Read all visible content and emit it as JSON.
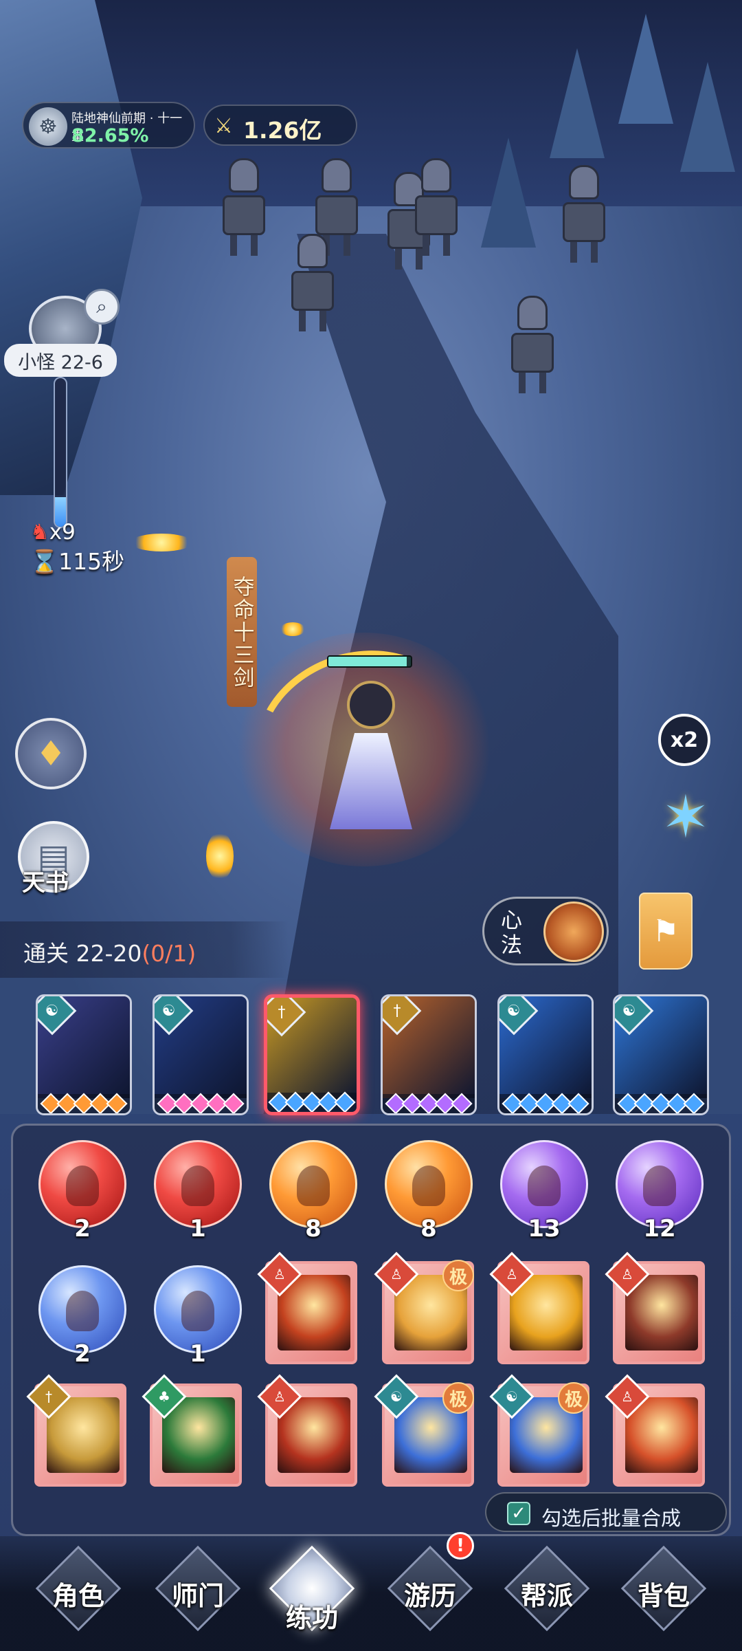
{
  "hud": {
    "realm": "陆地神仙前期 · 十一重",
    "realm_progress": "82.65%",
    "power": "1.26亿",
    "stage": "小怪 22-6",
    "wave_progress": 0.2,
    "kills": "x9",
    "timer": "115秒",
    "skill_banner": "夺命十三剑",
    "hero_hp": 0.95,
    "speed": "x2"
  },
  "side": {
    "book_label": "天书",
    "xinfa_label": "心法"
  },
  "clear": {
    "label": "通关 22-20",
    "progress": "(0/1)"
  },
  "skills": [
    {
      "icon": "yin-yang-icon",
      "gem": "#2d8a92",
      "pip": "#ff9a35",
      "art": "#3a3f8a"
    },
    {
      "icon": "yin-yang-icon",
      "gem": "#2d8a92",
      "pip": "#ff6fc0",
      "art": "#233d86"
    },
    {
      "icon": "sword-icon",
      "gem": "#b88a2a",
      "pip": "#4aa5ff",
      "art": "#c99a24",
      "active": true
    },
    {
      "icon": "sword-icon",
      "gem": "#b88a2a",
      "pip": "#b36cff",
      "art": "#b8632c"
    },
    {
      "icon": "yin-yang-icon",
      "gem": "#2d8a92",
      "pip": "#4aa5ff",
      "art": "#2c6bd0"
    },
    {
      "icon": "yin-yang-icon",
      "gem": "#2d8a92",
      "pip": "#4aa5ff",
      "art": "#2f77d8"
    }
  ],
  "orbs": [
    {
      "color": "red",
      "count": "2"
    },
    {
      "color": "red",
      "count": "1"
    },
    {
      "color": "orange",
      "count": "8"
    },
    {
      "color": "orange",
      "count": "8"
    },
    {
      "color": "purple",
      "count": "13"
    },
    {
      "color": "purple",
      "count": "12"
    },
    {
      "color": "blue",
      "count": "2"
    },
    {
      "color": "blue",
      "count": "1"
    }
  ],
  "cards_row2": [
    {
      "pic": "#c4421f",
      "tag": "#d94a3a",
      "tag_icon": "person-icon"
    },
    {
      "pic": "#e6a23a",
      "tag": "#d94a3a",
      "tag_icon": "person-icon",
      "ji": "极"
    },
    {
      "pic": "#e8a21e",
      "tag": "#d94a3a",
      "tag_icon": "person-icon"
    },
    {
      "pic": "#8e3a2a",
      "tag": "#d94a3a",
      "tag_icon": "person-icon"
    }
  ],
  "cards_row3": [
    {
      "pic": "#c79a3a",
      "tag": "#b88a2a",
      "tag_icon": "sword-icon"
    },
    {
      "pic": "#2c7a3a",
      "tag": "#2f9a63",
      "tag_icon": "leaf-icon"
    },
    {
      "pic": "#b5331f",
      "tag": "#d94a3a",
      "tag_icon": "person-icon"
    },
    {
      "pic": "#3d6fd8",
      "tag": "#2d8a92",
      "tag_icon": "yin-yang-icon",
      "ji": "极"
    },
    {
      "pic": "#3d6fd8",
      "tag": "#2d8a92",
      "tag_icon": "yin-yang-icon",
      "ji": "极"
    },
    {
      "pic": "#d6512a",
      "tag": "#d94a3a",
      "tag_icon": "person-icon"
    }
  ],
  "batch": {
    "label": "勾选后批量合成",
    "checked": true
  },
  "nav": [
    {
      "label": "角色"
    },
    {
      "label": "师门"
    },
    {
      "label": "练功",
      "active": true
    },
    {
      "label": "游历",
      "alert": "!"
    },
    {
      "label": "帮派"
    },
    {
      "label": "背包"
    }
  ]
}
